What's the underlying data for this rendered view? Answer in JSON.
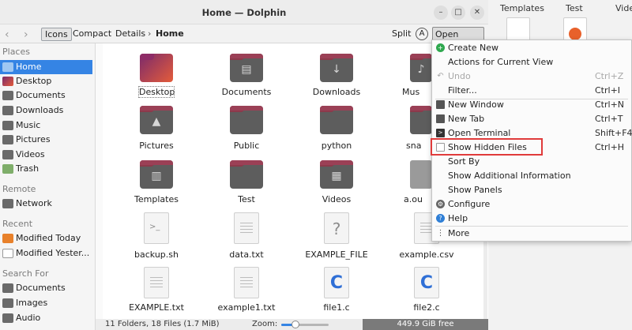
{
  "background_window": {
    "items": [
      "Templates",
      "Test",
      "Vide"
    ]
  },
  "window": {
    "title": "Home — Dolphin"
  },
  "toolbar": {
    "icons_label": "Icons",
    "compact_label": "Compact",
    "details_label": "Details",
    "location": "Home",
    "split_label": "Split",
    "open_menu_label": "Open Menu"
  },
  "sidebar": {
    "places_header": "Places",
    "places": [
      "Home",
      "Desktop",
      "Documents",
      "Downloads",
      "Music",
      "Pictures",
      "Videos",
      "Trash"
    ],
    "remote_header": "Remote",
    "remote": [
      "Network"
    ],
    "recent_header": "Recent",
    "recent": [
      "Modified Today",
      "Modified Yester..."
    ],
    "search_header": "Search For",
    "search": [
      "Documents",
      "Images",
      "Audio"
    ]
  },
  "files": {
    "row1": [
      "Desktop",
      "Documents",
      "Downloads",
      "Mus"
    ],
    "row2": [
      "Pictures",
      "Public",
      "python",
      "sna"
    ],
    "row3": [
      "Templates",
      "Test",
      "Videos",
      "a.ou"
    ],
    "row4": [
      "backup.sh",
      "data.txt",
      "EXAMPLE_FILE",
      "example.csv"
    ],
    "row5": [
      "EXAMPLE.txt",
      "example1.txt",
      "file1.c",
      "file2.c"
    ]
  },
  "statusbar": {
    "summary": "11 Folders, 18 Files (1.7 MiB)",
    "zoom_label": "Zoom:",
    "zoom_level": 0.3,
    "free_space": "449.9 GiB free"
  },
  "menu": {
    "items": [
      {
        "label": "Create New",
        "shortcut": ""
      },
      {
        "label": "Actions for Current View",
        "shortcut": ""
      },
      {
        "label": "Undo",
        "shortcut": "Ctrl+Z"
      },
      {
        "label": "Filter...",
        "shortcut": "Ctrl+I"
      },
      {
        "label": "New Window",
        "shortcut": "Ctrl+N"
      },
      {
        "label": "New Tab",
        "shortcut": "Ctrl+T"
      },
      {
        "label": "Open Terminal",
        "shortcut": "Shift+F4"
      },
      {
        "label": "Show Hidden Files",
        "shortcut": "Ctrl+H"
      },
      {
        "label": "Sort By",
        "shortcut": ""
      },
      {
        "label": "Show Additional Information",
        "shortcut": ""
      },
      {
        "label": "Show Panels",
        "shortcut": ""
      },
      {
        "label": "Configure",
        "shortcut": ""
      },
      {
        "label": "Help",
        "shortcut": ""
      },
      {
        "label": "More",
        "shortcut": ""
      }
    ]
  },
  "colors": {
    "accent": "#3584e4",
    "highlight_box": "#e03b3b"
  }
}
